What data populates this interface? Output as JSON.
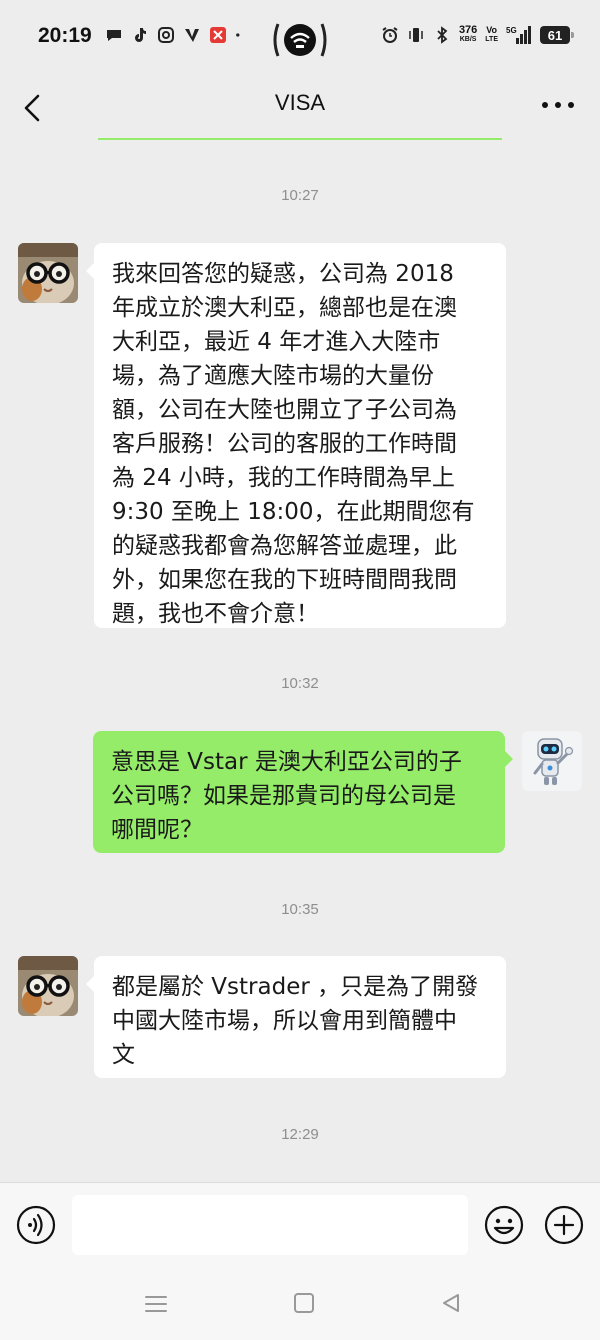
{
  "status_bar": {
    "time": "20:19",
    "net_speed_top": "376",
    "net_speed_unit": "KB/S",
    "volte_top": "Vo",
    "volte_bottom": "LTE",
    "signal_label": "5G",
    "battery": "61"
  },
  "nav": {
    "title": "VISA"
  },
  "messages": [
    {
      "type": "timestamp",
      "text": "10:27"
    },
    {
      "type": "incoming",
      "text": "我來回答您的疑惑，公司為 2018\n年成立於澳大利亞，總部也是在澳\n大利亞，最近 4 年才進入大陸市\n場，為了適應大陸市場的大量份\n額，公司在大陸也開立了子公司為\n客戶服務！公司的客服的工作時間\n為 24 小時，我的工作時間為早上\n9:30 至晚上 18:00，在此期間您有\n的疑惑我都會為您解答並處理，此\n外，如果您在我的下班時間問我問\n題，我也不會介意！"
    },
    {
      "type": "timestamp",
      "text": "10:32"
    },
    {
      "type": "outgoing",
      "text": "意思是 Vstar 是澳大利亞公司的子\n公司嗎？如果是那貴司的母公司是\n哪間呢？"
    },
    {
      "type": "timestamp",
      "text": "10:35"
    },
    {
      "type": "incoming",
      "text": "都是屬於 Vstrader ，只是為了開發\n中國大陸市場，所以會用到簡體中\n文"
    },
    {
      "type": "timestamp",
      "text": "12:29"
    }
  ],
  "input": {
    "value": ""
  },
  "colors": {
    "background": "#ededed",
    "outgoing_bubble": "#95ec69",
    "incoming_bubble": "#ffffff",
    "timestamp": "#8e8e8e"
  }
}
